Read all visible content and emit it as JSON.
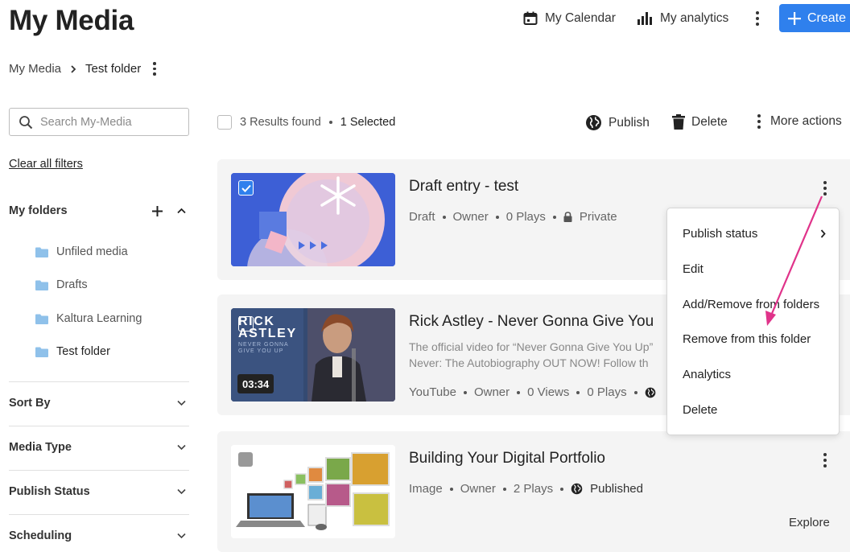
{
  "header": {
    "title": "My Media",
    "calendar_label": "My Calendar",
    "analytics_label": "My analytics",
    "create_label": "Create"
  },
  "breadcrumb": {
    "root": "My Media",
    "current": "Test folder"
  },
  "sidebar": {
    "search_placeholder": "Search My-Media",
    "clear_filters": "Clear all filters",
    "folders_title": "My folders",
    "folders": [
      {
        "label": "Unfiled media"
      },
      {
        "label": "Drafts"
      },
      {
        "label": "Kaltura Learning"
      },
      {
        "label": "Test folder"
      }
    ],
    "filters": [
      {
        "label": "Sort By"
      },
      {
        "label": "Media Type"
      },
      {
        "label": "Publish Status"
      },
      {
        "label": "Scheduling"
      }
    ]
  },
  "toolbar": {
    "results": "3 Results found",
    "selected": "1 Selected",
    "publish_label": "Publish",
    "delete_label": "Delete",
    "more_label": "More actions"
  },
  "entries": [
    {
      "title": "Draft entry - test",
      "meta": [
        "Draft",
        "Owner",
        "0 Plays",
        "Private"
      ],
      "selected": true
    },
    {
      "title": "Rick Astley - Never Gonna Give You",
      "desc_line1": "The official video for “Never Gonna Give You Up”",
      "desc_line2": "Never: The Autobiography OUT NOW! Follow th",
      "meta": [
        "YouTube",
        "Owner",
        "0 Views",
        "0 Plays"
      ],
      "duration": "03:34",
      "thumb_text_1": "RICK",
      "thumb_text_2": "ASTLEY",
      "thumb_text_3": "NEVER GONNA",
      "thumb_text_4": "GIVE YOU UP",
      "thumb_text_5": "4K",
      "selected": false
    },
    {
      "title": "Building Your Digital Portfolio",
      "meta": [
        "Image",
        "Owner",
        "2 Plays",
        "Published"
      ],
      "explore_label": "Explore",
      "selected": false
    }
  ],
  "menu": {
    "items": [
      {
        "label": "Publish status"
      },
      {
        "label": "Edit"
      },
      {
        "label": "Add/Remove from folders"
      },
      {
        "label": "Remove from this folder"
      },
      {
        "label": "Analytics"
      },
      {
        "label": "Delete"
      }
    ]
  },
  "colors": {
    "accent": "#2f80ed",
    "card_bg": "#f4f4f4",
    "arrow": "#e0338a",
    "folder_icon": "#8fc1ea"
  }
}
